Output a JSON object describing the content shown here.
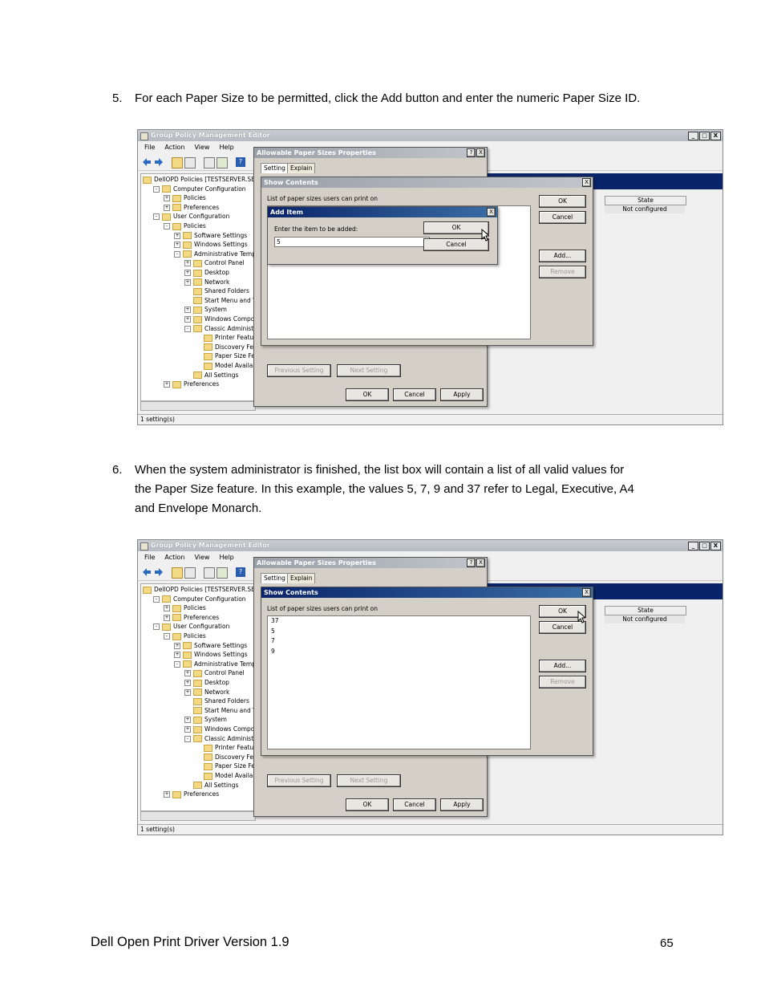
{
  "step5": {
    "number": "5.",
    "text": "For each Paper Size to be permitted, click the Add button and enter the numeric Paper Size ID."
  },
  "step6": {
    "number": "6.",
    "line1": "When the system administrator is finished, the list box will contain a list of all valid values for",
    "line2": "the Paper Size feature.  In this example, the values 5, 7, 9 and 37 refer to Legal, Executive, A4",
    "line3": "and Envelope Monarch."
  },
  "screenshot": {
    "window_title": "Group Policy Management Editor",
    "menu": [
      "File",
      "Action",
      "View",
      "Help"
    ],
    "tree": [
      {
        "label": "DellOPD Policies [TESTSERVER.SERV",
        "indent": 0,
        "exp": ""
      },
      {
        "label": "Computer Configuration",
        "indent": 1,
        "exp": "-"
      },
      {
        "label": "Policies",
        "indent": 2,
        "exp": "+"
      },
      {
        "label": "Preferences",
        "indent": 2,
        "exp": "+"
      },
      {
        "label": "User Configuration",
        "indent": 1,
        "exp": "-"
      },
      {
        "label": "Policies",
        "indent": 2,
        "exp": "-"
      },
      {
        "label": "Software Settings",
        "indent": 3,
        "exp": "+"
      },
      {
        "label": "Windows Settings",
        "indent": 3,
        "exp": "+"
      },
      {
        "label": "Administrative Template",
        "indent": 3,
        "exp": "-"
      },
      {
        "label": "Control Panel",
        "indent": 4,
        "exp": "+"
      },
      {
        "label": "Desktop",
        "indent": 4,
        "exp": "+"
      },
      {
        "label": "Network",
        "indent": 4,
        "exp": "+"
      },
      {
        "label": "Shared Folders",
        "indent": 4,
        "exp": ""
      },
      {
        "label": "Start Menu and Tas",
        "indent": 4,
        "exp": ""
      },
      {
        "label": "System",
        "indent": 4,
        "exp": "+"
      },
      {
        "label": "Windows Componer",
        "indent": 4,
        "exp": "+"
      },
      {
        "label": "Classic Administrati",
        "indent": 4,
        "exp": "-"
      },
      {
        "label": "Printer Feature",
        "indent": 5,
        "exp": ""
      },
      {
        "label": "Discovery Feat",
        "indent": 5,
        "exp": ""
      },
      {
        "label": "Paper Size Feat",
        "indent": 5,
        "exp": ""
      },
      {
        "label": "Model Availabili",
        "indent": 5,
        "exp": ""
      },
      {
        "label": "All Settings",
        "indent": 4,
        "exp": ""
      },
      {
        "label": "Preferences",
        "indent": 2,
        "exp": "+"
      }
    ],
    "column_state": "State",
    "state_value": "Not configured",
    "status": "1 setting(s)",
    "props_title": "Allowable Paper Sizes Properties",
    "props_help": "?",
    "props_close": "X",
    "tab_setting": "Setting",
    "tab_explain": "Explain",
    "prev_setting": "Previous Setting",
    "next_setting": "Next Setting",
    "ok": "OK",
    "cancel": "Cancel",
    "apply": "Apply",
    "show_title": "Show Contents",
    "show_close": "X",
    "list_label": "List of paper sizes users can print on",
    "add": "Add...",
    "remove": "Remove",
    "add_title": "Add Item",
    "add_close": "X",
    "add_label": "Enter the item to be added:",
    "add_value": "5",
    "win_min": "_",
    "win_max": "□",
    "win_close": "X",
    "list_values": [
      "37",
      "5",
      "7",
      "9"
    ]
  },
  "footer": {
    "title": "Dell Open Print Driver Version 1.9",
    "page": "65"
  }
}
